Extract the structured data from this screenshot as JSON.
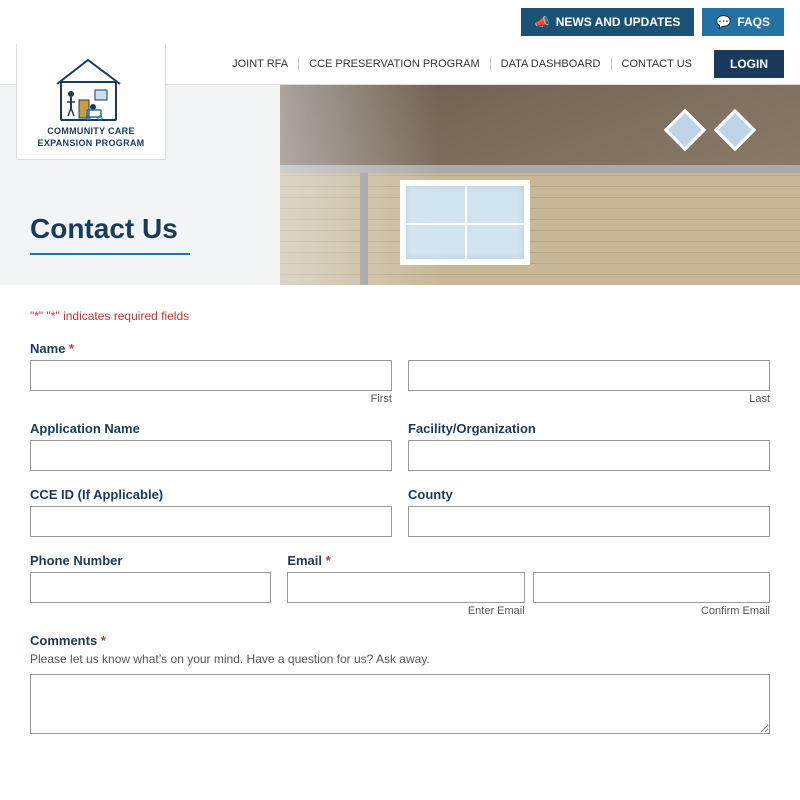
{
  "header": {
    "logo_line1": "COMMUNITY CARE",
    "logo_line2": "EXPANSION PROGRAM",
    "news_btn": "NEWS AND UPDATES",
    "faqs_btn": "FAQs",
    "nav": {
      "joint_rfa": "JOINT RFA",
      "cce_preservation": "CCE PRESERVATION PROGRAM",
      "data_dashboard": "DATA DASHBOARD",
      "contact_us": "CONTACT US",
      "login": "LOGIN"
    }
  },
  "hero": {
    "title": "Contact Us"
  },
  "form": {
    "required_note_prefix": "\"*\" indicates required fields",
    "required_marker": "*",
    "name_label": "Name",
    "first_sublabel": "First",
    "last_sublabel": "Last",
    "app_name_label": "Application Name",
    "facility_label": "Facility/Organization",
    "cce_id_label": "CCE ID (If Applicable)",
    "county_label": "County",
    "phone_label": "Phone Number",
    "email_label": "Email",
    "enter_email_sublabel": "Enter Email",
    "confirm_email_sublabel": "Confirm Email",
    "comments_label": "Comments",
    "comments_hint": "Please let us know what’s on your mind. Have a question for us? Ask away."
  }
}
